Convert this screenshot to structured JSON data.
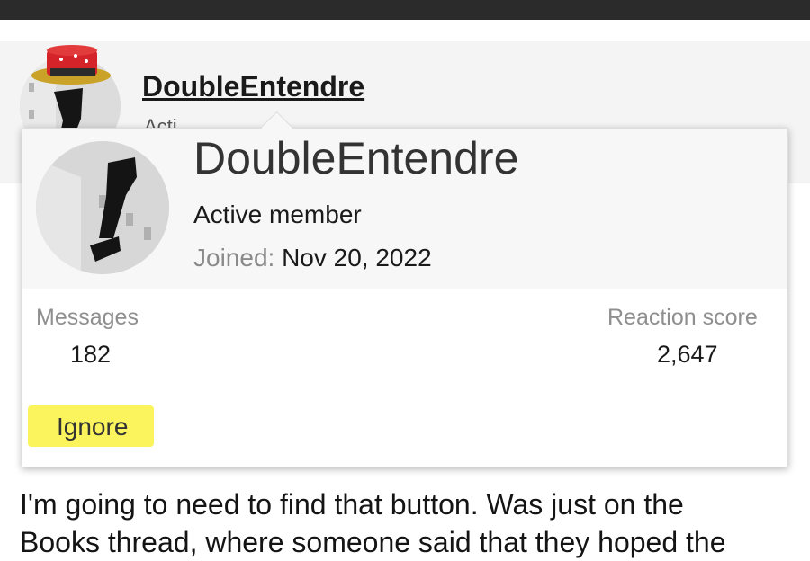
{
  "post": {
    "username": "DoubleEntendre",
    "status_partial": "Acti",
    "body_line1": "I'm going to need to find that button. Was just on the",
    "body_line2": "Books thread, where someone said that they hoped the"
  },
  "member_card": {
    "username": "DoubleEntendre",
    "user_title": "Active member",
    "joined_label": "Joined:",
    "joined_value": "Nov 20, 2022",
    "stats": {
      "messages_label": "Messages",
      "messages_value": "182",
      "reaction_label": "Reaction score",
      "reaction_value": "2,647"
    },
    "ignore_label": "Ignore"
  },
  "colors": {
    "highlight": "#fbf45c",
    "top_bar": "#2b2b2b",
    "muted_label": "#8f8f8f"
  },
  "icons": {
    "post_avatar": "avatar-with-cake-hat",
    "card_avatar": "avatar-legs-image"
  }
}
